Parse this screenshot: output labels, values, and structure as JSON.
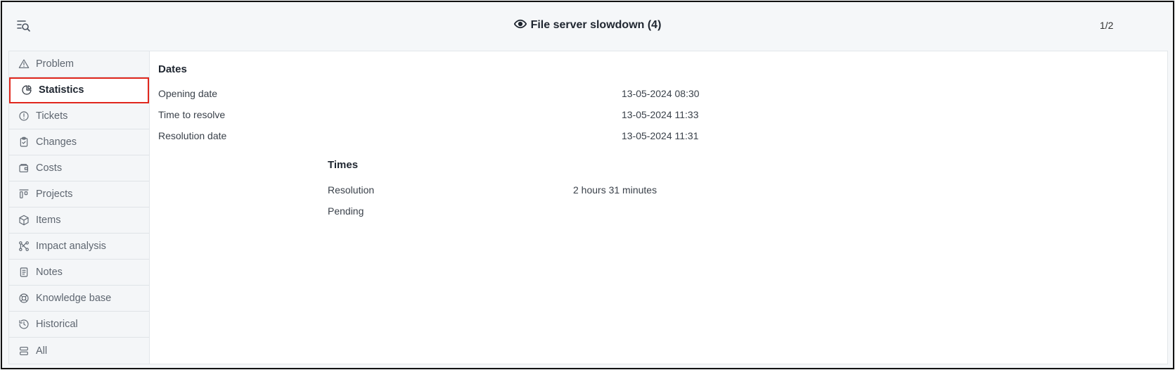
{
  "header": {
    "title": "File server slowdown (4)",
    "pager": "1/2"
  },
  "sidebar": {
    "items": [
      {
        "label": "Problem",
        "icon": "warning-triangle-icon"
      },
      {
        "label": "Statistics",
        "icon": "pie-chart-icon",
        "active": true
      },
      {
        "label": "Tickets",
        "icon": "exclamation-circle-icon"
      },
      {
        "label": "Changes",
        "icon": "clipboard-check-icon"
      },
      {
        "label": "Costs",
        "icon": "wallet-icon"
      },
      {
        "label": "Projects",
        "icon": "kanban-icon"
      },
      {
        "label": "Items",
        "icon": "package-icon"
      },
      {
        "label": "Impact analysis",
        "icon": "network-icon"
      },
      {
        "label": "Notes",
        "icon": "note-icon"
      },
      {
        "label": "Knowledge base",
        "icon": "lifebuoy-icon"
      },
      {
        "label": "Historical",
        "icon": "history-icon"
      },
      {
        "label": "All",
        "icon": "layers-icon"
      }
    ]
  },
  "dates": {
    "title": "Dates",
    "rows": [
      {
        "label": "Opening date",
        "value": "13-05-2024 08:30"
      },
      {
        "label": "Time to resolve",
        "value": "13-05-2024 11:33"
      },
      {
        "label": "Resolution date",
        "value": "13-05-2024 11:31"
      }
    ]
  },
  "times": {
    "title": "Times",
    "rows": [
      {
        "label": "Resolution",
        "value": "2 hours 31 minutes"
      },
      {
        "label": "Pending",
        "value": ""
      }
    ]
  },
  "colors": {
    "active_outline": "#e0271d",
    "text": "#1f2630",
    "muted": "#5e6670"
  }
}
